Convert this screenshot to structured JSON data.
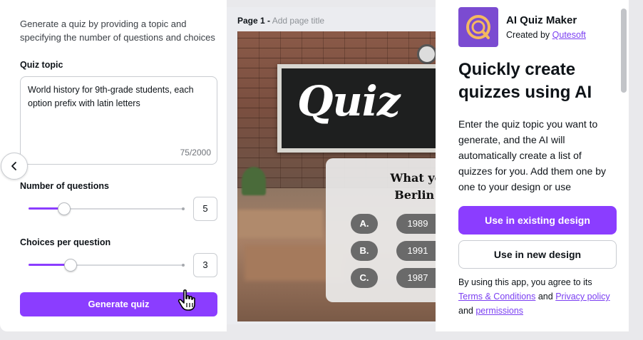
{
  "left_panel": {
    "intro": "Generate a quiz by providing a topic and specifying the number of questions and choices",
    "topic_label": "Quiz topic",
    "topic_value": "World history for 9th-grade students, each option prefix with latin letters",
    "topic_counter": "75/2000",
    "questions_label": "Number of questions",
    "questions_value": "5",
    "questions_slider_fraction": 0.23,
    "choices_label": "Choices per question",
    "choices_value": "3",
    "choices_slider_fraction": 0.27,
    "generate_label": "Generate quiz"
  },
  "canvas": {
    "page_label": "Page 1 -",
    "page_title_placeholder": "Add page title",
    "board_title": "Quiz",
    "question": "What year Berlin W",
    "options": [
      {
        "letter": "A.",
        "value": "1989"
      },
      {
        "letter": "B.",
        "value": "1991"
      },
      {
        "letter": "C.",
        "value": "1987"
      }
    ]
  },
  "right_panel": {
    "app_name": "AI Quiz Maker",
    "created_by_prefix": "Created by",
    "creator": "Qutesoft",
    "headline": "Quickly create quizzes using AI",
    "description": "Enter the quiz topic you want to generate, and the AI will automatically create a list of quizzes for you. Add them one by one to your design or use",
    "use_existing_label": "Use in existing design",
    "use_new_label": "Use in new design",
    "terms_prefix": "By using this app, you agree to its",
    "terms_link": "Terms & Conditions",
    "and1": "and",
    "privacy_link": "Privacy policy",
    "and2": "and",
    "permissions_link": "permissions"
  },
  "colors": {
    "accent": "#8b3dff",
    "link": "#7b3ff2"
  }
}
